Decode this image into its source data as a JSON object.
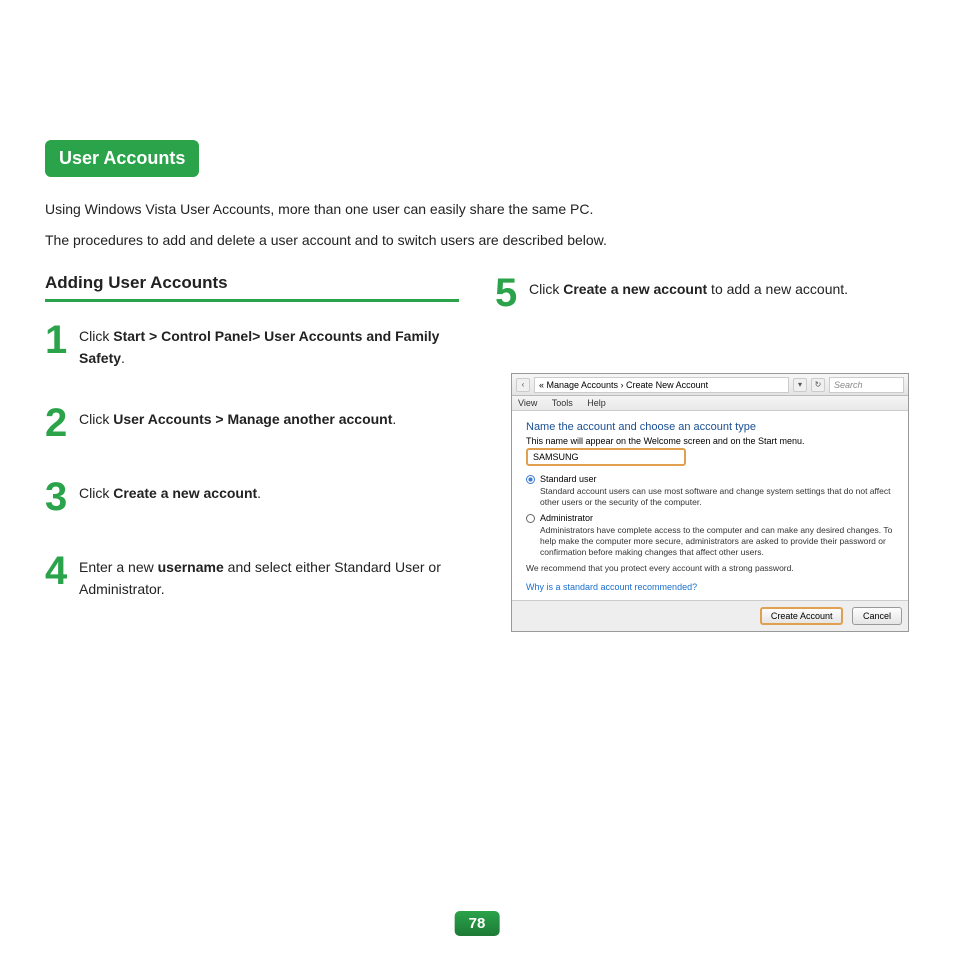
{
  "title_badge": "User Accounts",
  "intro_line1": "Using Windows Vista User Accounts, more than one user can easily share the same PC.",
  "intro_line2": "The procedures to add and delete a user account and to switch users are described below.",
  "section_heading": "Adding User Accounts",
  "steps": {
    "s1": {
      "num": "1",
      "pre": "Click ",
      "bold": "Start > Control Panel> User Accounts and Family Safety",
      "post": "."
    },
    "s2": {
      "num": "2",
      "pre": "Click ",
      "bold": "User Accounts > Manage another account",
      "post": "."
    },
    "s3": {
      "num": "3",
      "pre": "Click ",
      "bold": "Create a new account",
      "post": "."
    },
    "s4": {
      "num": "4",
      "pre": "Enter a new ",
      "bold": "username",
      "post": " and select either Standard User or Administrator."
    },
    "s5": {
      "num": "5",
      "pre": "Click ",
      "bold": "Create a new account",
      "post": " to add a new account."
    }
  },
  "shot": {
    "breadcrumb": "« Manage Accounts  ›  Create New Account",
    "search_placeholder": "Search",
    "menu": {
      "view": "View",
      "tools": "Tools",
      "help": "Help"
    },
    "heading": "Name the account and choose an account type",
    "subtext": "This name will appear on the Welcome screen and on the Start menu.",
    "name_value": "SAMSUNG",
    "std_label": "Standard user",
    "std_desc": "Standard account users can use most software and change system settings that do not affect other users or the security of the computer.",
    "admin_label": "Administrator",
    "admin_desc": "Administrators have complete access to the computer and can make any desired changes. To help make the computer more secure, administrators are asked to provide their password or confirmation before making changes that affect other users.",
    "recommend": "We recommend that you protect every account with a strong password.",
    "link": "Why is a standard account recommended?",
    "btn_create": "Create Account",
    "btn_cancel": "Cancel"
  },
  "page_number": "78"
}
